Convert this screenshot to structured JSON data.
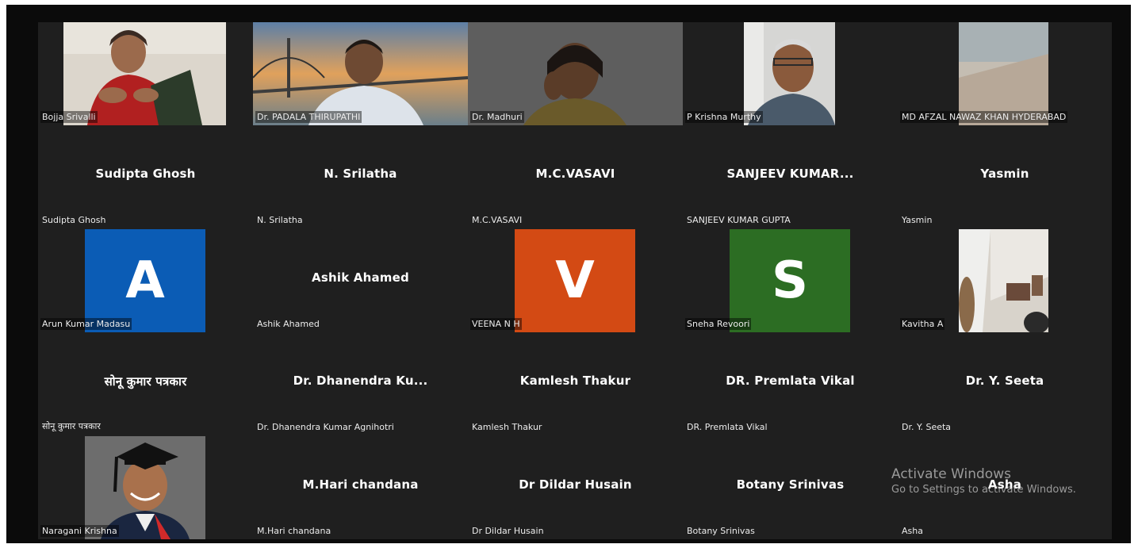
{
  "participants": [
    {
      "label": "Bojja Srivalli",
      "display": "",
      "kind": "video",
      "video_bg": "#d8d2c8"
    },
    {
      "label": "Dr. PADALA THIRUPATHI",
      "display": "",
      "kind": "video",
      "video_bg": "#c48a55"
    },
    {
      "label": "Dr. Madhuri",
      "display": "",
      "kind": "video",
      "video_bg": "#6a6a6a"
    },
    {
      "label": "P Krishna Murthy",
      "display": "",
      "kind": "video",
      "video_bg": "#cfcfcf"
    },
    {
      "label": "MD AFZAL NAWAZ KHAN HYDERABAD",
      "display": "",
      "kind": "video",
      "video_bg": "#b9b3a8"
    },
    {
      "label": "Sudipta Ghosh",
      "display": "Sudipta Ghosh",
      "kind": "name"
    },
    {
      "label": "N. Srilatha",
      "display": "N. Srilatha",
      "kind": "name"
    },
    {
      "label": "M.C.VASAVI",
      "display": "M.C.VASAVI",
      "kind": "name"
    },
    {
      "label": "SANJEEV KUMAR GUPTA",
      "display": "SANJEEV  KUMAR...",
      "kind": "name"
    },
    {
      "label": "Yasmin",
      "display": "Yasmin",
      "kind": "name"
    },
    {
      "label": "Arun Kumar Madasu",
      "display": "A",
      "kind": "avatar",
      "avatar_color": "#0b5cb5"
    },
    {
      "label": "Ashik Ahamed",
      "display": "Ashik Ahamed",
      "kind": "name"
    },
    {
      "label": "VEENA N H",
      "display": "V",
      "kind": "avatar",
      "avatar_color": "#d34a14"
    },
    {
      "label": "Sneha Revoori",
      "display": "S",
      "kind": "avatar",
      "avatar_color": "#2c6d23"
    },
    {
      "label": "Kavitha A",
      "display": "",
      "kind": "video",
      "video_bg": "#c9c2b8"
    },
    {
      "label": "सोनू कुमार पत्रकार",
      "display": "सोनू कुमार पत्रकार",
      "kind": "name"
    },
    {
      "label": "Dr. Dhanendra Kumar Agnihotri",
      "display": "Dr.  Dhanendra  Ku...",
      "kind": "name"
    },
    {
      "label": "Kamlesh Thakur",
      "display": "Kamlesh Thakur",
      "kind": "name"
    },
    {
      "label": "DR. Premlata Vikal",
      "display": "DR. Premlata Vikal",
      "kind": "name"
    },
    {
      "label": "Dr. Y. Seeta",
      "display": "Dr. Y. Seeta",
      "kind": "name"
    },
    {
      "label": "Naragani Krishna",
      "display": "",
      "kind": "video",
      "video_bg": "#7a7a7a"
    },
    {
      "label": "M.Hari chandana",
      "display": "M.Hari chandana",
      "kind": "name"
    },
    {
      "label": "Dr Dildar Husain",
      "display": "Dr Dildar Husain",
      "kind": "name"
    },
    {
      "label": "Botany Srinivas",
      "display": "Botany Srinivas",
      "kind": "name"
    },
    {
      "label": "Asha",
      "display": "Asha",
      "kind": "name"
    }
  ],
  "watermark": {
    "line1": "Activate Windows",
    "line2": "Go to Settings to activate Windows."
  }
}
